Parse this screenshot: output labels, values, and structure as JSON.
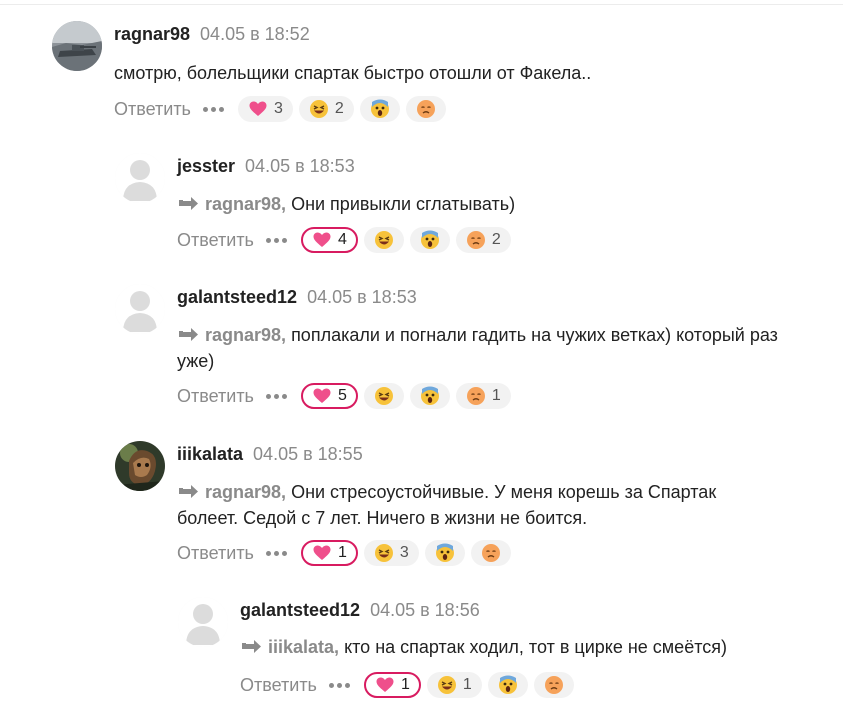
{
  "comments": [
    {
      "author": "ragnar98",
      "time": "04.05 в 18:52",
      "reply_to": "",
      "text": "смотрю, болельщики спартак быстро отошли от Факела..",
      "answer": "Ответить",
      "reactions": {
        "heart": "3",
        "laugh": "2",
        "shock": "",
        "sad": ""
      }
    },
    {
      "author": "jesster",
      "time": "04.05 в 18:53",
      "reply_to": "ragnar98,",
      "text": "Они привыкли сглатывать)",
      "answer": "Ответить",
      "reactions": {
        "heart": "4",
        "laugh": "",
        "shock": "",
        "sad": "2"
      }
    },
    {
      "author": "galantsteed12",
      "time": "04.05 в 18:53",
      "reply_to": "ragnar98,",
      "text": "поплакали и погнали гадить на чужих ветках) который раз уже)",
      "answer": "Ответить",
      "reactions": {
        "heart": "5",
        "laugh": "",
        "shock": "",
        "sad": "1"
      }
    },
    {
      "author": "iiikalata",
      "time": "04.05 в 18:55",
      "reply_to": "ragnar98,",
      "text": "Они стресоустойчивые. У меня корешь за Спартак болеет. Седой с 7 лет. Ничего в жизни не боится.",
      "answer": "Ответить",
      "reactions": {
        "heart": "1",
        "laugh": "3",
        "shock": "",
        "sad": ""
      }
    },
    {
      "author": "galantsteed12",
      "time": "04.05 в 18:56",
      "reply_to": "iiikalata,",
      "text": "кто на спартак ходил, тот в цирке не смеётся)",
      "answer": "Ответить",
      "reactions": {
        "heart": "1",
        "laugh": "1",
        "shock": "",
        "sad": ""
      }
    }
  ],
  "colors": {
    "accent": "#d81b60",
    "muted": "#8a8a8a",
    "pill": "#f2f2f2"
  },
  "icons": [
    "heart-emoji-icon",
    "laughing-emoji-icon",
    "shocked-emoji-icon",
    "sad-emoji-icon",
    "reply-arrow-icon",
    "more-dots-icon",
    "default-avatar-icon"
  ]
}
